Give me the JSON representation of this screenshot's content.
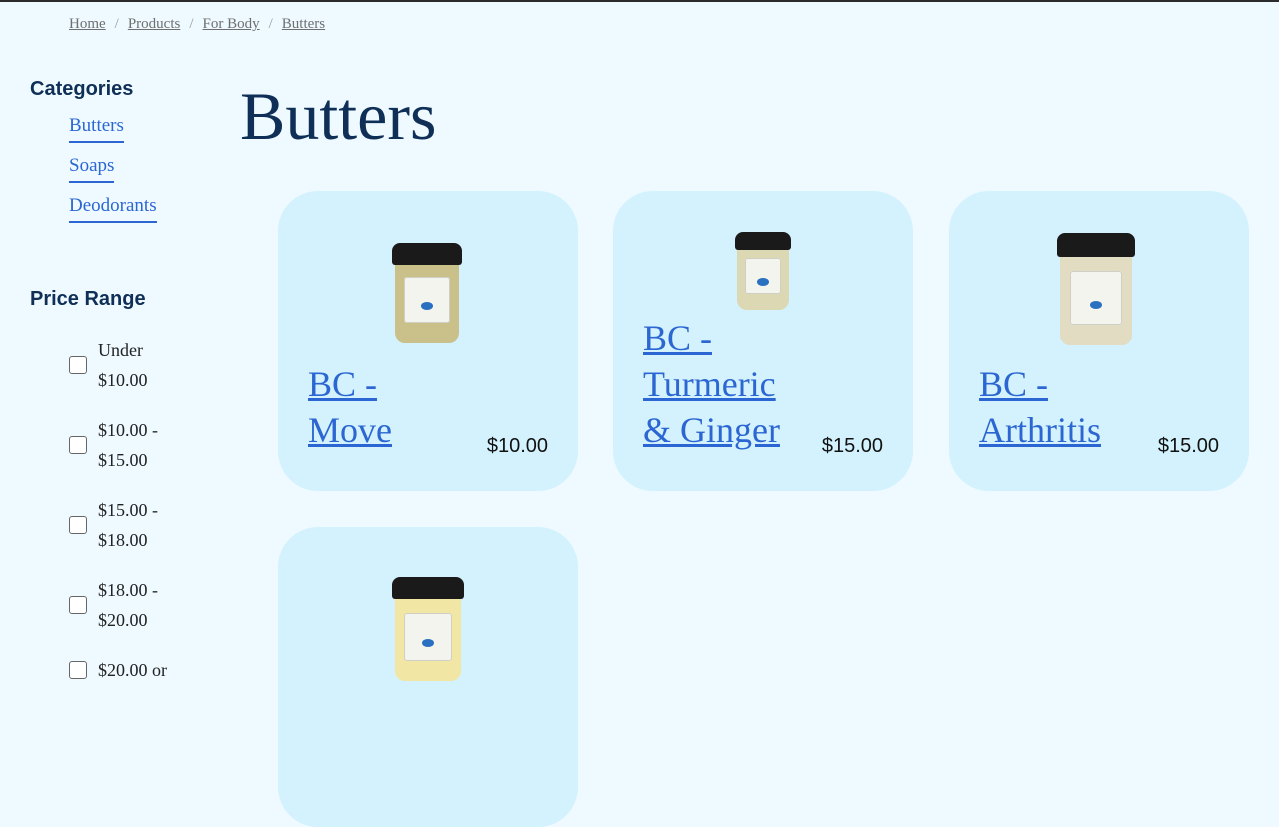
{
  "breadcrumb": {
    "items": [
      "Home",
      "Products",
      "For Body",
      "Butters"
    ],
    "separator": "/"
  },
  "sidebar": {
    "categories_heading": "Categories",
    "categories": [
      "Butters",
      "Soaps",
      "Deodorants"
    ],
    "price_heading": "Price Range",
    "price_ranges": [
      {
        "line1": "Under",
        "line2": "$10.00"
      },
      {
        "line1": "$10.00 -",
        "line2": "$15.00"
      },
      {
        "line1": "$15.00 -",
        "line2": "$18.00"
      },
      {
        "line1": "$18.00 -",
        "line2": "$20.00"
      },
      {
        "line1": "$20.00 or",
        "line2": ""
      }
    ]
  },
  "page": {
    "title": "Butters"
  },
  "products": [
    {
      "name": "BC - Move",
      "price": "$10.00",
      "image_icon": "jar-icon"
    },
    {
      "name": "BC - Turmeric & Ginger",
      "price": "$15.00",
      "image_icon": "jar-icon"
    },
    {
      "name": "BC - Arthritis",
      "price": "$15.00",
      "image_icon": "jar-icon"
    },
    {
      "name": "",
      "price": "",
      "image_icon": "jar-icon"
    }
  ],
  "colors": {
    "background": "#eefaff",
    "card": "#d3f2fd",
    "link": "#2b66d2",
    "heading": "#0f2f57"
  }
}
